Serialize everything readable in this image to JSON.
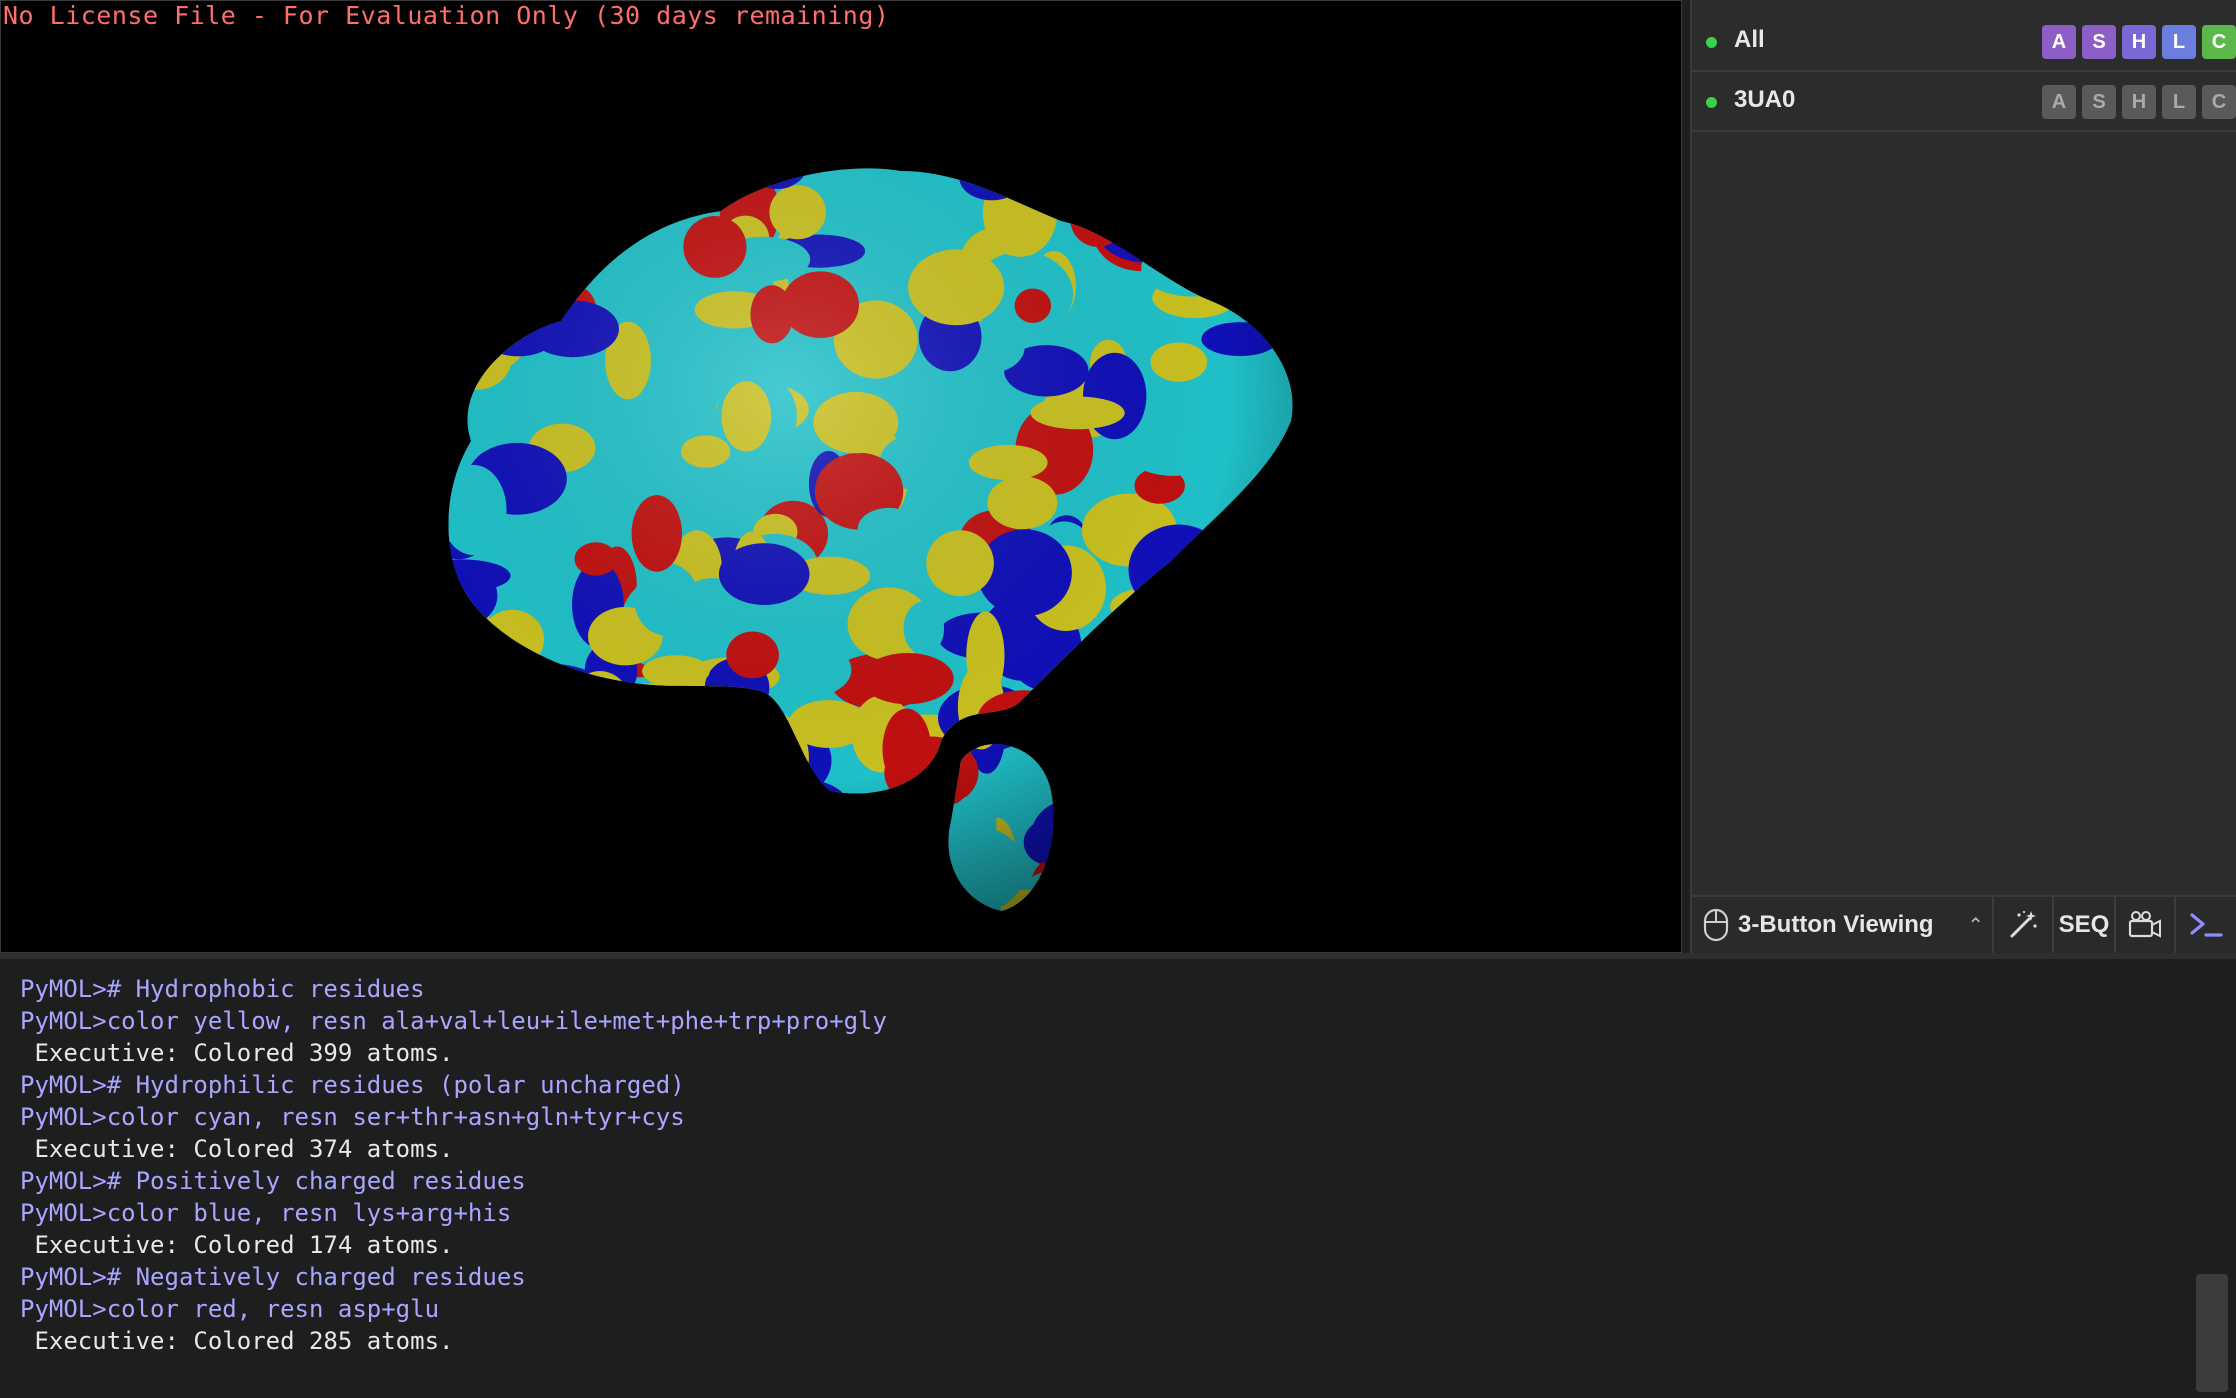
{
  "viewport": {
    "license_text": "No License File - For Evaluation Only (30 days remaining)"
  },
  "objects": [
    {
      "name": "All",
      "enabled": true,
      "buttons": [
        {
          "label": "A",
          "color": "#8e5ec7"
        },
        {
          "label": "S",
          "color": "#8e5ec7"
        },
        {
          "label": "H",
          "color": "#7a68d6"
        },
        {
          "label": "L",
          "color": "#6b7ee0"
        },
        {
          "label": "C",
          "color": "#5cb84a"
        }
      ]
    },
    {
      "name": "3UA0",
      "enabled": true,
      "buttons": [
        {
          "label": "A",
          "color": "#5a5a5a"
        },
        {
          "label": "S",
          "color": "#5a5a5a"
        },
        {
          "label": "H",
          "color": "#5a5a5a"
        },
        {
          "label": "L",
          "color": "#5a5a5a"
        },
        {
          "label": "C",
          "color": "#5a5a5a"
        }
      ]
    }
  ],
  "toolbar": {
    "mouse_mode": "3-Button Viewing",
    "seq_label": "SEQ",
    "icons": [
      "mouse-icon",
      "chevron-up-icon",
      "wizard-icon",
      "movie-icon",
      "console-prompt-icon"
    ]
  },
  "console": {
    "lines": [
      {
        "text": "PyMOL># Hydrophobic residues",
        "kind": "cmd"
      },
      {
        "text": "PyMOL>color yellow, resn ala+val+leu+ile+met+phe+trp+pro+gly",
        "kind": "cmd"
      },
      {
        "text": " Executive: Colored 399 atoms.",
        "kind": "out"
      },
      {
        "text": "PyMOL># Hydrophilic residues (polar uncharged)",
        "kind": "cmd"
      },
      {
        "text": "PyMOL>color cyan, resn ser+thr+asn+gln+tyr+cys",
        "kind": "cmd"
      },
      {
        "text": " Executive: Colored 374 atoms.",
        "kind": "out"
      },
      {
        "text": "PyMOL># Positively charged residues",
        "kind": "cmd"
      },
      {
        "text": "PyMOL>color blue, resn lys+arg+his",
        "kind": "cmd"
      },
      {
        "text": " Executive: Colored 174 atoms.",
        "kind": "out"
      },
      {
        "text": "PyMOL># Negatively charged residues",
        "kind": "cmd"
      },
      {
        "text": "PyMOL>color red, resn asp+glu",
        "kind": "cmd"
      },
      {
        "text": " Executive: Colored 285 atoms.",
        "kind": "out"
      }
    ]
  },
  "colors": {
    "hydrophobic": "#c8c020",
    "hydrophilic": "#20c0c8",
    "positive": "#1010b8",
    "negative": "#c01010",
    "enabled_dot": "#3bd14a"
  }
}
